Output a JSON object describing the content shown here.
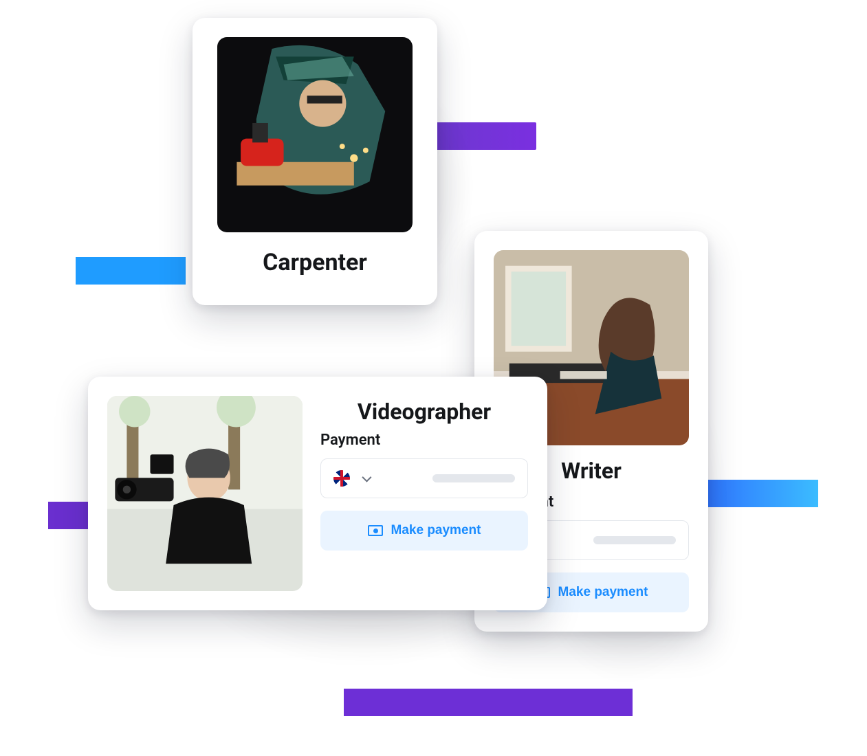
{
  "cards": {
    "carpenter": {
      "title": "Carpenter"
    },
    "videographer": {
      "title": "Videographer",
      "payment_label": "Payment",
      "button_label": "Make payment",
      "currency": "GBP"
    },
    "writer": {
      "title": "Writer",
      "payment_label": "Payment",
      "button_label": "Make payment"
    }
  },
  "colors": {
    "accent_blue": "#1a8cff",
    "accent_purple": "#6a2fcf",
    "button_bg": "#eaf4ff"
  }
}
